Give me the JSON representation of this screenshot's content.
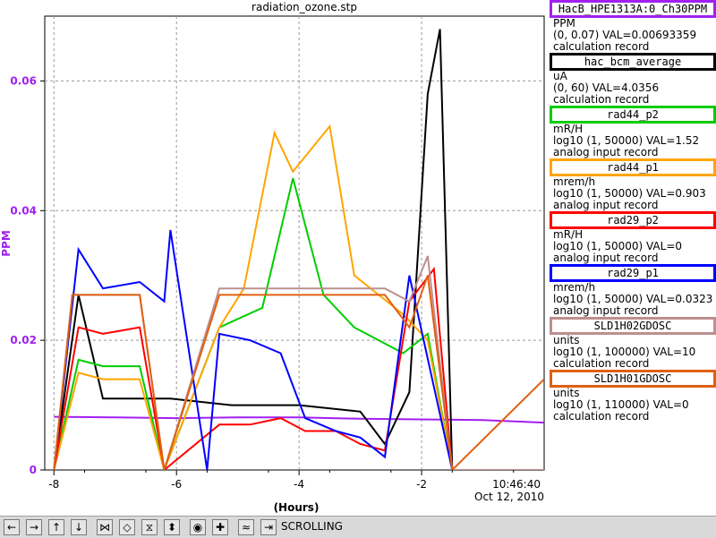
{
  "window_title": "radiation_ozone.stp",
  "chart_data": {
    "type": "line",
    "title": "radiation_ozone.stp",
    "xlabel": "(Hours)",
    "ylabel": "PPM",
    "xlim": [
      -8.15,
      0
    ],
    "ylim": [
      0,
      0.07
    ],
    "x_ticks": [
      -8,
      -6,
      -4,
      -2
    ],
    "y_ticks": [
      0,
      0.02,
      0.04,
      0.06
    ],
    "y_tick_labels": [
      "0",
      "0.02",
      "0.04",
      "0.06"
    ],
    "end_time": "10:46:40",
    "end_date": "Oct 12, 2010",
    "grid": true,
    "series": [
      {
        "name": "HacB_HPE1313A:0_Ch30PPM",
        "color": "#a020f0",
        "x": [
          -8,
          -7,
          -6,
          -5,
          -4,
          -3,
          -2,
          -1,
          0
        ],
        "y": [
          0.0082,
          0.0081,
          0.008,
          0.0081,
          0.0081,
          0.0079,
          0.0078,
          0.0077,
          0.0073
        ]
      },
      {
        "name": "hac_bcm_average",
        "color": "#000000",
        "x": [
          -8,
          -7.6,
          -7.2,
          -6.6,
          -6.1,
          -5.1,
          -4.5,
          -4.0,
          -3.0,
          -2.6,
          -2.2,
          -1.9,
          -1.7,
          -1.5,
          0
        ],
        "y": [
          0,
          0.027,
          0.011,
          0.011,
          0.011,
          0.01,
          0.01,
          0.01,
          0.009,
          0.004,
          0.012,
          0.058,
          0.068,
          0,
          0
        ]
      },
      {
        "name": "rad44_p2",
        "color": "#00cc00",
        "x": [
          -8,
          -7.6,
          -7.2,
          -6.6,
          -6.2,
          -5.3,
          -4.6,
          -4.1,
          -3.6,
          -3.1,
          -2.7,
          -2.3,
          -1.9,
          -1.5,
          0
        ],
        "y": [
          0,
          0.017,
          0.016,
          0.016,
          0,
          0.022,
          0.025,
          0.045,
          0.027,
          0.022,
          0.02,
          0.018,
          0.021,
          0,
          0
        ]
      },
      {
        "name": "rad44_p1",
        "color": "#ffa500",
        "x": [
          -8,
          -7.6,
          -7.2,
          -6.6,
          -6.2,
          -5.3,
          -4.9,
          -4.4,
          -4.1,
          -3.5,
          -3.1,
          -2.7,
          -2.3,
          -1.9,
          -1.5,
          0
        ],
        "y": [
          0,
          0.015,
          0.014,
          0.014,
          0,
          0.022,
          0.028,
          0.052,
          0.046,
          0.053,
          0.03,
          0.027,
          0.024,
          0.02,
          0,
          0
        ]
      },
      {
        "name": "rad29_p2",
        "color": "#ff0000",
        "x": [
          -8,
          -7.6,
          -7.2,
          -6.6,
          -6.2,
          -5.3,
          -4.8,
          -4.3,
          -3.9,
          -3.4,
          -3.0,
          -2.6,
          -2.2,
          -1.8,
          -1.5,
          0
        ],
        "y": [
          0,
          0.022,
          0.021,
          0.022,
          0,
          0.007,
          0.007,
          0.008,
          0.006,
          0.006,
          0.004,
          0.003,
          0.026,
          0.031,
          0,
          0
        ]
      },
      {
        "name": "rad29_p1",
        "color": "#0000ff",
        "x": [
          -8,
          -7.6,
          -7.2,
          -6.6,
          -6.2,
          -6.1,
          -5.5,
          -5.3,
          -4.8,
          -4.3,
          -3.9,
          -3.4,
          -3.0,
          -2.6,
          -2.2,
          -1.5,
          0
        ],
        "y": [
          0,
          0.034,
          0.028,
          0.029,
          0.026,
          0.037,
          0,
          0.021,
          0.02,
          0.018,
          0.008,
          0.006,
          0.005,
          0.002,
          0.03,
          0,
          0
        ]
      },
      {
        "name": "SLD1H02GDOSC",
        "color": "#bc8f8f",
        "x": [
          -8,
          -7.7,
          -7.2,
          -6.6,
          -6.2,
          -5.3,
          -4.6,
          -4.0,
          -3.5,
          -3.0,
          -2.6,
          -2.2,
          -1.9,
          -1.5,
          0
        ],
        "y": [
          0,
          0.027,
          0.027,
          0.027,
          0,
          0.028,
          0.028,
          0.028,
          0.028,
          0.028,
          0.028,
          0.026,
          0.033,
          0,
          0
        ]
      },
      {
        "name": "SLD1H01GDOSC",
        "color": "#e06010",
        "x": [
          -8,
          -7.7,
          -7.2,
          -6.6,
          -6.2,
          -5.3,
          -4.6,
          -4.0,
          -3.5,
          -3.0,
          -2.6,
          -2.2,
          -1.9,
          -1.5,
          0
        ],
        "y": [
          0,
          0.027,
          0.027,
          0.027,
          0,
          0.027,
          0.027,
          0.027,
          0.027,
          0.027,
          0.027,
          0.022,
          0.03,
          0,
          0.014
        ]
      }
    ]
  },
  "legend": [
    {
      "name": "HacB_HPE1313A:0_Ch30PPM",
      "color": "#a020f0",
      "units": "PPM",
      "range": "(0, 0.07) VAL=0.00693359",
      "record": "calculation record"
    },
    {
      "name": "hac_bcm_average",
      "color": "#000000",
      "units": "uA",
      "range": "(0, 60) VAL=4.0356",
      "record": "calculation record"
    },
    {
      "name": "rad44_p2",
      "color": "#00cc00",
      "units": "mR/H",
      "range": "log10 (1, 50000) VAL=1.52",
      "record": "analog input record"
    },
    {
      "name": "rad44_p1",
      "color": "#ffa500",
      "units": "mrem/h",
      "range": "log10 (1, 50000) VAL=0.903",
      "record": "analog input record"
    },
    {
      "name": "rad29_p2",
      "color": "#ff0000",
      "units": "mR/H",
      "range": "log10 (1, 50000) VAL=0",
      "record": "analog input record"
    },
    {
      "name": "rad29_p1",
      "color": "#0000ff",
      "units": "mrem/h",
      "range": "log10 (1, 50000) VAL=0.0323",
      "record": "analog input record"
    },
    {
      "name": "SLD1H02GDOSC",
      "color": "#bc8f8f",
      "units": "units",
      "range": "log10 (1, 100000) VAL=10",
      "record": "calculation record"
    },
    {
      "name": "SLD1H01GDOSC",
      "color": "#e06010",
      "units": "units",
      "range": "log10 (1, 110000) VAL=0",
      "record": "calculation record"
    }
  ],
  "toolbar": {
    "buttons": [
      {
        "name": "pan-left-button",
        "icon": "arrow-left-icon",
        "glyph": "←"
      },
      {
        "name": "pan-right-button",
        "icon": "arrow-right-icon",
        "glyph": "→"
      },
      {
        "name": "pan-up-button",
        "icon": "arrow-up-icon",
        "glyph": "↑"
      },
      {
        "name": "pan-down-button",
        "icon": "arrow-down-icon",
        "glyph": "↓"
      },
      {
        "name": "zoom-in-x-button",
        "icon": "zoom-in-x-icon",
        "glyph": "⋈"
      },
      {
        "name": "zoom-out-x-button",
        "icon": "zoom-out-x-icon",
        "glyph": "◇"
      },
      {
        "name": "zoom-in-y-button",
        "icon": "zoom-in-y-icon",
        "glyph": "⧖"
      },
      {
        "name": "zoom-out-y-button",
        "icon": "zoom-out-y-icon",
        "glyph": "⬍"
      },
      {
        "name": "auto-zoom-button",
        "icon": "target-icon",
        "glyph": "◉"
      },
      {
        "name": "stagger-button",
        "icon": "plus-icon",
        "glyph": "✚"
      },
      {
        "name": "undo-zoom-button",
        "icon": "undo-zoom-icon",
        "glyph": "≈"
      },
      {
        "name": "scroll-button",
        "icon": "scroll-icon",
        "glyph": "⇥"
      }
    ],
    "mode": "SCROLLING"
  }
}
